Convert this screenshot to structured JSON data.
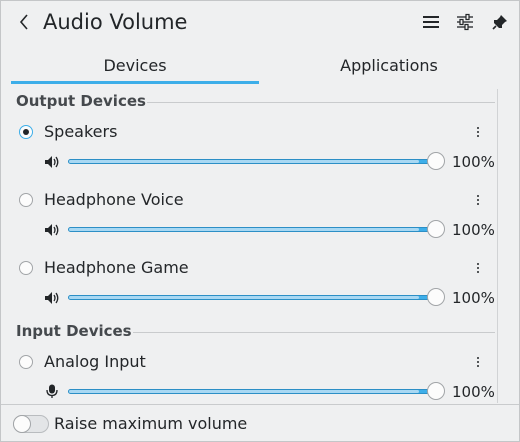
{
  "header": {
    "title": "Audio Volume",
    "icons": [
      "back-icon",
      "hamburger-menu-icon",
      "settings-sliders-icon",
      "pin-icon"
    ]
  },
  "tabs": [
    {
      "label": "Devices",
      "active": true
    },
    {
      "label": "Applications",
      "active": false
    }
  ],
  "sections": {
    "output": {
      "title": "Output Devices",
      "devices": [
        {
          "label": "Speakers",
          "selected": true,
          "volume": "100%",
          "level": 1.0
        },
        {
          "label": "Headphone Voice",
          "selected": false,
          "volume": "100%",
          "level": 1.0
        },
        {
          "label": "Headphone Game",
          "selected": false,
          "volume": "100%",
          "level": 1.0
        }
      ]
    },
    "input": {
      "title": "Input Devices",
      "devices": [
        {
          "label": "Analog Input",
          "selected": false,
          "volume": "100%",
          "level": 1.0
        }
      ]
    }
  },
  "footer": {
    "raise_max_label": "Raise maximum volume",
    "raise_max_enabled": false
  },
  "colors": {
    "accent": "#3daee9",
    "background": "#eff0f1",
    "text": "#232629"
  }
}
